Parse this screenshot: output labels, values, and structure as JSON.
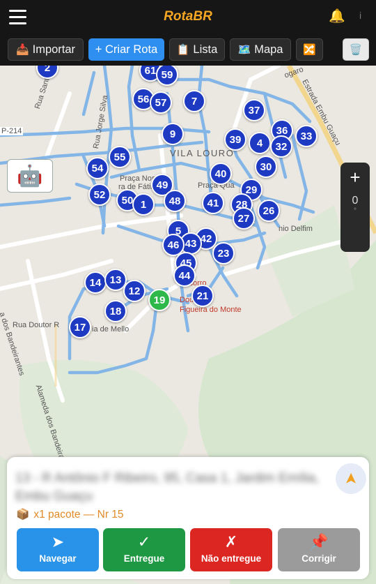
{
  "header": {
    "title": "RotaBR",
    "bell_icon": "🔔",
    "more_icon": "i"
  },
  "toolbar": {
    "importar": {
      "icon": "📥",
      "label": "Importar"
    },
    "criar_rota": {
      "label": "+ Criar Rota"
    },
    "lista": {
      "icon": "📋",
      "label": "Lista"
    },
    "mapa": {
      "icon": "🗺️",
      "label": "Mapa"
    },
    "shuffle": {
      "icon": "🔀"
    },
    "trash": {
      "icon": "🗑️"
    }
  },
  "map": {
    "robot_icon": "🤖",
    "zoom_in": "+",
    "zoom_level": "0",
    "zoom_unit": "°",
    "labels": {
      "vila_louro": "VILA LOURO",
      "sp214": "P-214",
      "rua_santo_antonio": "Rua Santo Antônio",
      "rua_jorge": "Rua Jorge Silva",
      "praca_nossa": "Praça Nossa",
      "de_fatima": "ra de Fátima",
      "praca_qua": "Praça Qua",
      "estrada_embu": "Estrada Embu Guaçu",
      "rua_dos_bandeirantes": "a dos Bandeirantes",
      "rua_doutor": "Rua Doutor R",
      "de_mello": "ia de Mello",
      "alameda": "Alameda dos Bandeirantes",
      "socorro": "Socorro",
      "doutor": "Doutor",
      "figueira": "Figueira do Monte",
      "delfim": "nio Delfim",
      "ogaro": "ogaro"
    },
    "pins": [
      {
        "n": "2",
        "green": false
      },
      {
        "n": "61",
        "green": false
      },
      {
        "n": "59",
        "green": false
      },
      {
        "n": "56",
        "green": false
      },
      {
        "n": "57",
        "green": false
      },
      {
        "n": "7",
        "green": false
      },
      {
        "n": "37",
        "green": false
      },
      {
        "n": "36",
        "green": false
      },
      {
        "n": "33",
        "green": false
      },
      {
        "n": "9",
        "green": false
      },
      {
        "n": "39",
        "green": false
      },
      {
        "n": "4",
        "green": false
      },
      {
        "n": "32",
        "green": false
      },
      {
        "n": "55",
        "green": false
      },
      {
        "n": "54",
        "green": false
      },
      {
        "n": "30",
        "green": false
      },
      {
        "n": "40",
        "green": false
      },
      {
        "n": "49",
        "green": false
      },
      {
        "n": "52",
        "green": false
      },
      {
        "n": "50",
        "green": false
      },
      {
        "n": "1",
        "green": false
      },
      {
        "n": "48",
        "green": false
      },
      {
        "n": "41",
        "green": false
      },
      {
        "n": "29",
        "green": false
      },
      {
        "n": "28",
        "green": false
      },
      {
        "n": "26",
        "green": false
      },
      {
        "n": "27",
        "green": false
      },
      {
        "n": "5",
        "green": false
      },
      {
        "n": "42",
        "green": false
      },
      {
        "n": "43",
        "green": false
      },
      {
        "n": "46",
        "green": false
      },
      {
        "n": "23",
        "green": false
      },
      {
        "n": "45",
        "green": false
      },
      {
        "n": "44",
        "green": false
      },
      {
        "n": "14",
        "green": false
      },
      {
        "n": "13",
        "green": false
      },
      {
        "n": "12",
        "green": false
      },
      {
        "n": "19",
        "green": true
      },
      {
        "n": "21",
        "green": false
      },
      {
        "n": "18",
        "green": false
      },
      {
        "n": "17",
        "green": false
      }
    ]
  },
  "panel": {
    "address": "13 - R Antônio F Ribeiro, 95, Casa 1, Jardim Emília, Embu Guaçu",
    "nav_icon": "➤",
    "package_icon": "📦",
    "package_text": "x1 pacote — Nr 15",
    "buttons": {
      "navegar": {
        "icon": "➤",
        "label": "Navegar"
      },
      "entregue": {
        "icon": "✓",
        "label": "Entregue"
      },
      "nao_entregue": {
        "icon": "✗",
        "label": "Não entregue"
      },
      "corrigir": {
        "icon": "📌",
        "label": "Corrigir"
      }
    }
  }
}
